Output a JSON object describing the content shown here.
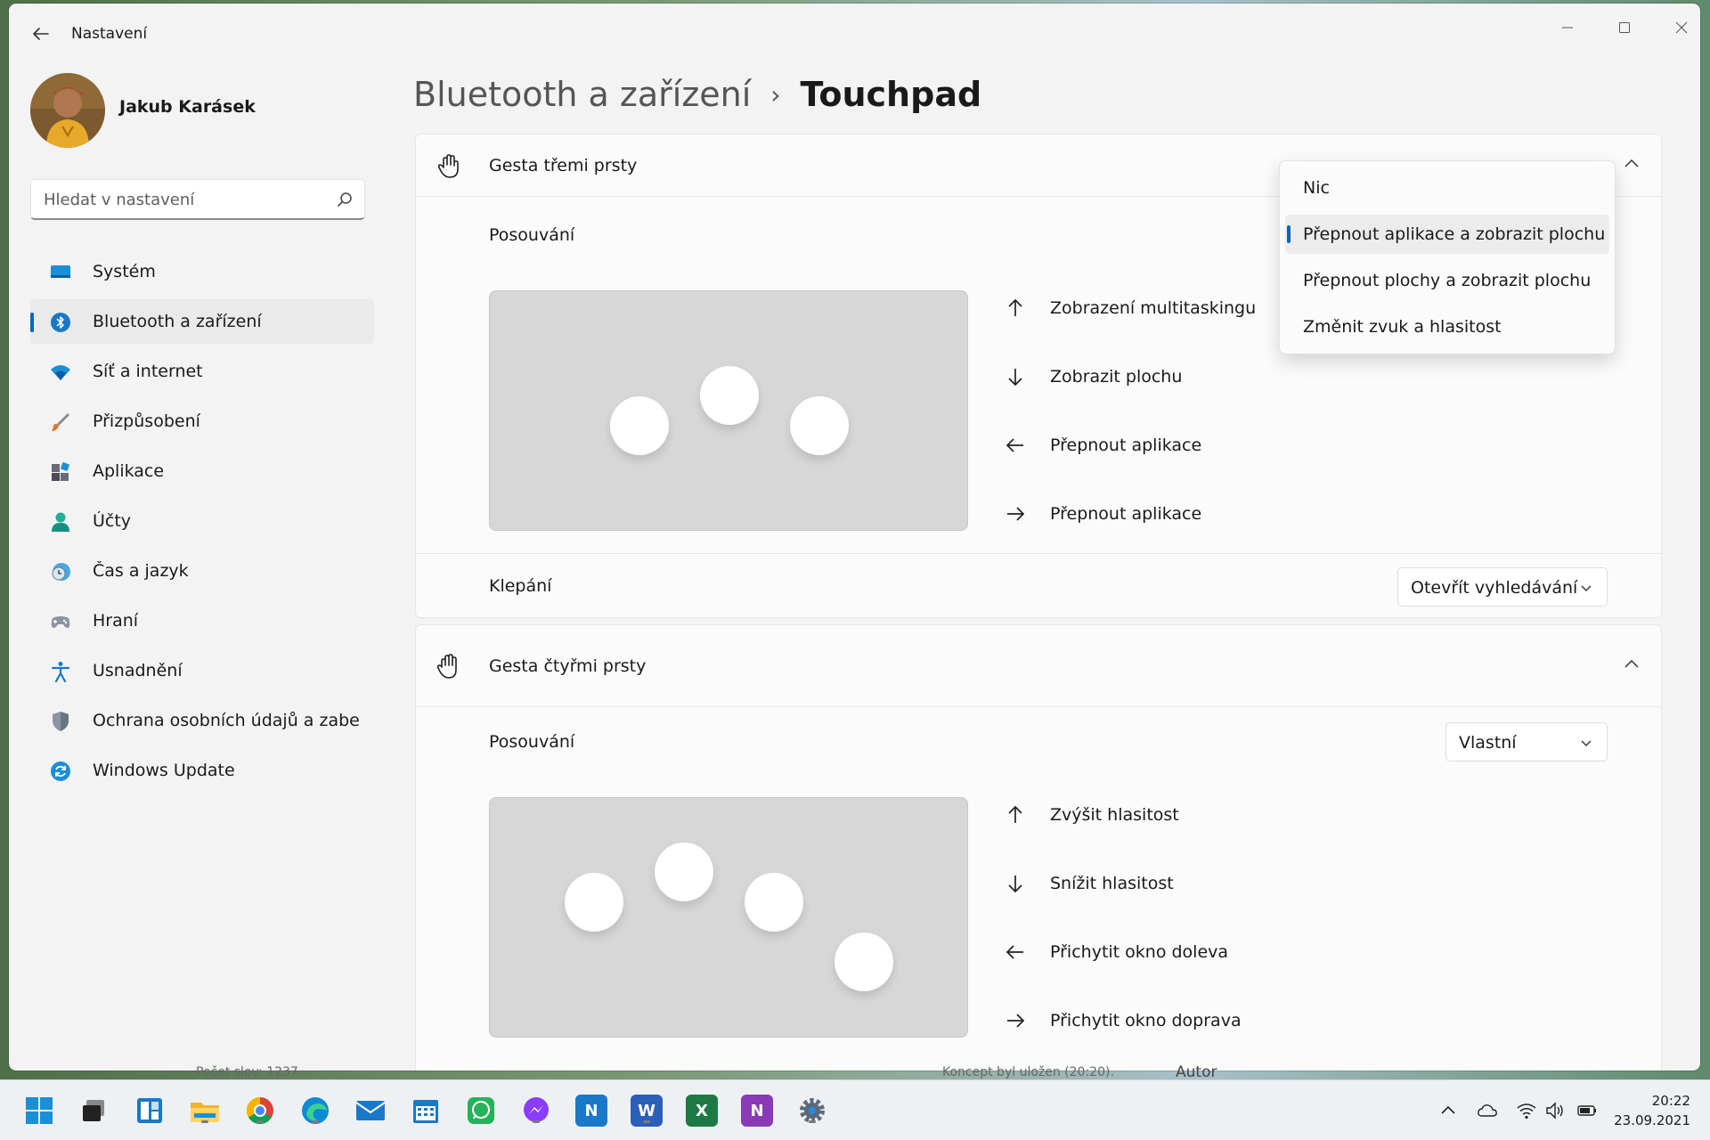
{
  "app": {
    "title": "Nastavení"
  },
  "profile": {
    "name": "Jakub Karásek"
  },
  "search": {
    "placeholder": "Hledat v nastavení"
  },
  "sidebar": {
    "items": [
      {
        "label": "Systém",
        "icon": "monitor-icon"
      },
      {
        "label": "Bluetooth a zařízení",
        "icon": "bluetooth-icon",
        "active": true
      },
      {
        "label": "Síť a internet",
        "icon": "wifi-icon"
      },
      {
        "label": "Přizpůsobení",
        "icon": "brush-icon"
      },
      {
        "label": "Aplikace",
        "icon": "apps-icon"
      },
      {
        "label": "Účty",
        "icon": "account-icon"
      },
      {
        "label": "Čas a jazyk",
        "icon": "clock-globe-icon"
      },
      {
        "label": "Hraní",
        "icon": "gamepad-icon"
      },
      {
        "label": "Usnadnění",
        "icon": "accessibility-icon"
      },
      {
        "label": "Ochrana osobních údajů a zabezpečení",
        "icon": "shield-icon"
      },
      {
        "label": "Windows Update",
        "icon": "update-icon"
      }
    ]
  },
  "breadcrumb": {
    "parent": "Bluetooth a zařízení",
    "separator": "›",
    "current": "Touchpad"
  },
  "three_finger": {
    "title": "Gesta třemi prsty",
    "swipe_label": "Posouvání",
    "gestures": [
      {
        "direction": "up",
        "label": "Zobrazení multitaskingu"
      },
      {
        "direction": "down",
        "label": "Zobrazit plochu"
      },
      {
        "direction": "left",
        "label": "Přepnout aplikace"
      },
      {
        "direction": "right",
        "label": "Přepnout aplikace"
      }
    ],
    "tap_label": "Klepání",
    "tap_value": "Otevřít vyhledávání"
  },
  "swipe_menu": {
    "options": [
      {
        "label": "Nic"
      },
      {
        "label": "Přepnout aplikace a zobrazit plochu",
        "selected": true
      },
      {
        "label": "Přepnout plochy a zobrazit plochu"
      },
      {
        "label": "Změnit zvuk a hlasitost"
      }
    ]
  },
  "four_finger": {
    "title": "Gesta čtyřmi prsty",
    "swipe_label": "Posouvání",
    "swipe_value": "Vlastní",
    "gestures": [
      {
        "direction": "up",
        "label": "Zvýšit hlasitost"
      },
      {
        "direction": "down",
        "label": "Snížit hlasitost"
      },
      {
        "direction": "left",
        "label": "Přichytit okno doleva"
      },
      {
        "direction": "right",
        "label": "Přichytit okno doprava"
      }
    ]
  },
  "behind": {
    "left": "Počet slov: 1237",
    "middle": "Koncept byl uložen (20:20).",
    "right": "Autor"
  },
  "taskbar": {
    "icons": [
      "windows-start-icon",
      "task-view-icon",
      "widgets-icon",
      "file-explorer-icon",
      "chrome-icon",
      "edge-icon",
      "mail-icon",
      "calendar-icon",
      "whatsapp-icon",
      "messenger-icon",
      "notepad-n-icon",
      "word-icon",
      "excel-icon",
      "onenote-icon",
      "settings-icon"
    ],
    "word_letter": "W",
    "excel_letter": "X",
    "onenote_letter": "N",
    "n_letter": "N",
    "time": "20:22",
    "date": "23.09.2021"
  },
  "colors": {
    "accent": "#0067c0",
    "window_bg": "#f3f3f3",
    "card_bg": "#fbfbfb"
  }
}
